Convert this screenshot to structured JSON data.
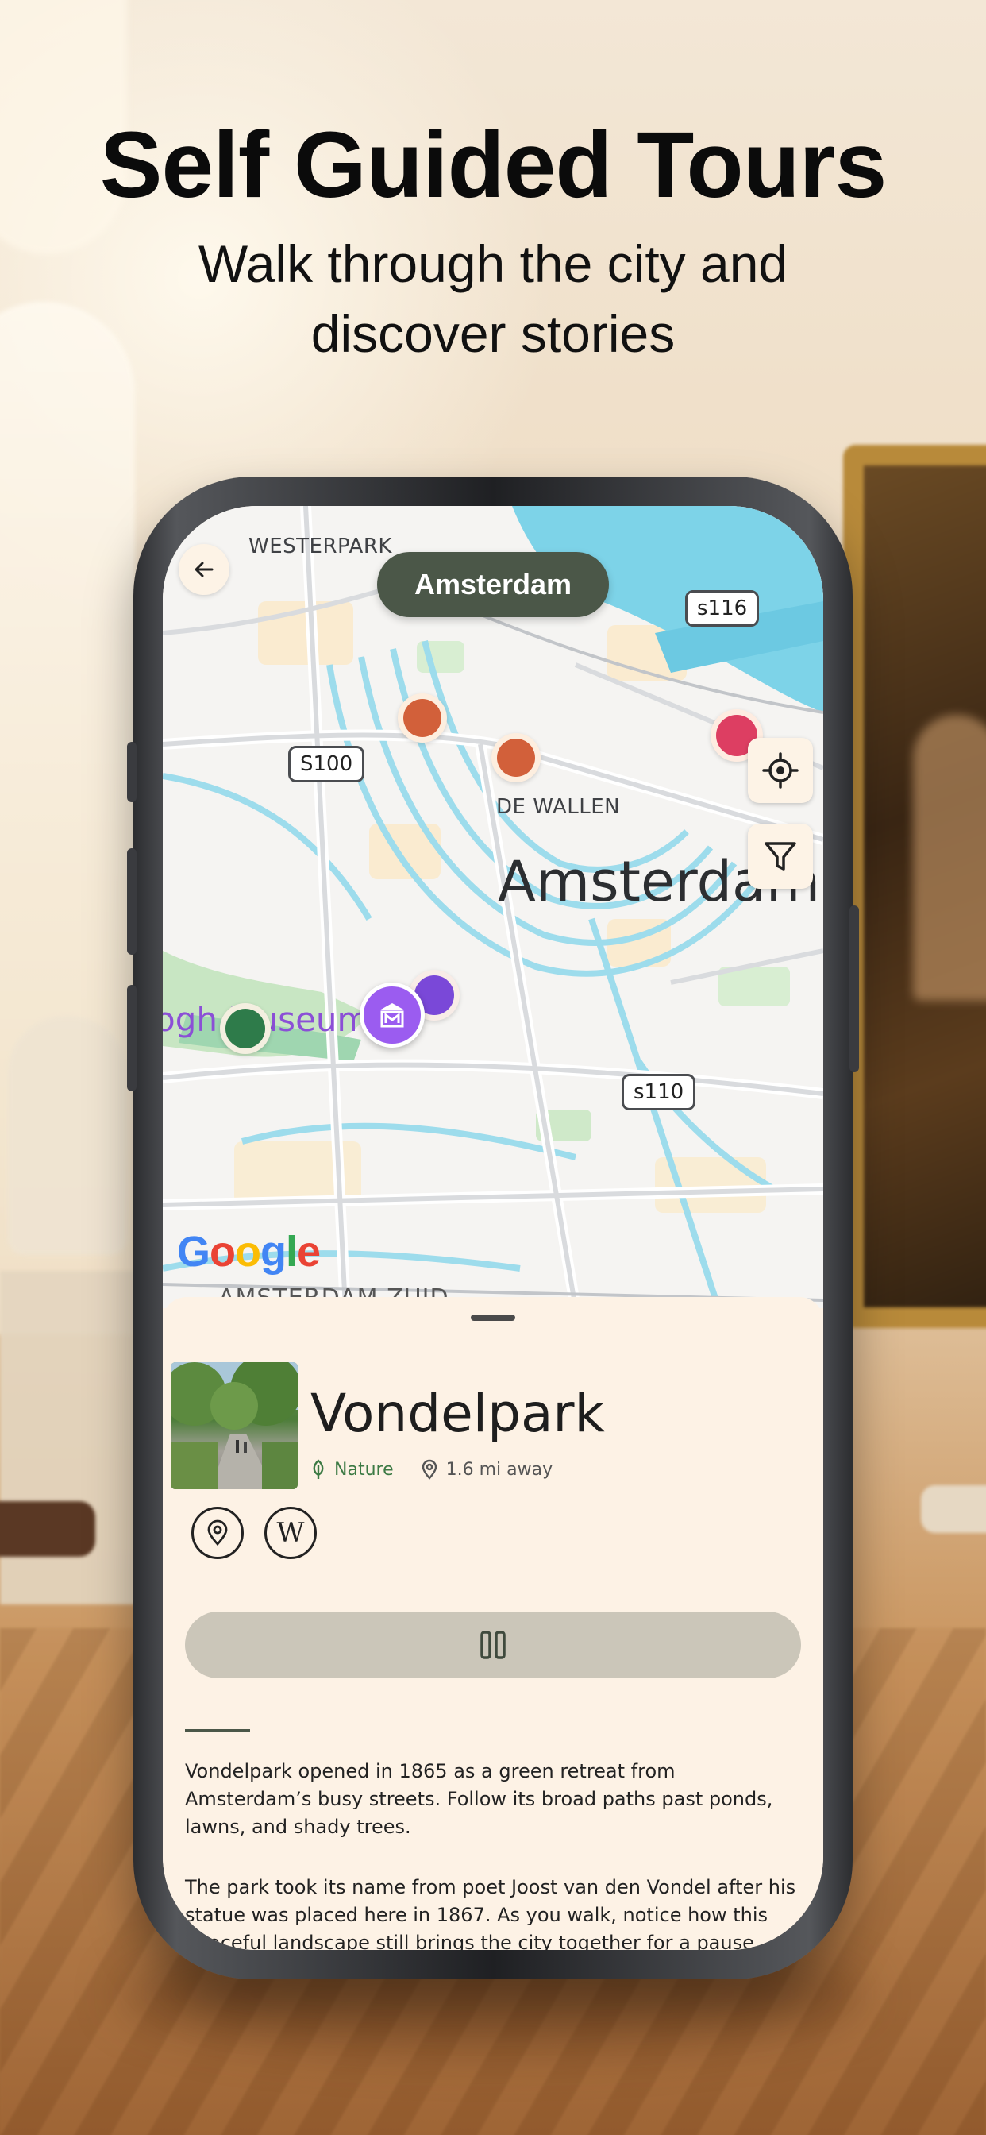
{
  "marketing": {
    "headline": "Self Guided Tours",
    "subheadline": "Walk through the city and discover stories"
  },
  "map": {
    "city_pill": "Amsterdam",
    "labels": {
      "westerpark": "WESTERPARK",
      "de_wallen": "DE WALLEN",
      "city": "Amsterdam",
      "museum": "ogh Museum",
      "zuid": "AMSTERDAM ZUID"
    },
    "road_shields": {
      "s100": "S100",
      "s116": "s116",
      "s110": "s110"
    },
    "google": "Google",
    "pins": [
      {
        "color": "#d2603a",
        "category": "orange"
      },
      {
        "color": "#d2603a",
        "category": "orange"
      },
      {
        "color": "#dd3e62",
        "category": "pink"
      },
      {
        "color": "#7a48d8",
        "category": "purple"
      },
      {
        "color": "#2e7b4a",
        "category": "nature"
      }
    ],
    "icons": {
      "back": "arrow-left-icon",
      "locate": "crosshair-icon",
      "filter": "filter-icon",
      "museum": "museum-icon"
    }
  },
  "place": {
    "title": "Vondelpark",
    "category": "Nature",
    "distance": "1.6 mi away",
    "description_1": "Vondelpark opened in 1865 as a green retreat from Amsterdam’s busy streets. Follow its broad paths past ponds, lawns, and shady trees.",
    "description_2": "The park took its name from poet Joost van den Vondel after his statue was placed here in 1867. As you walk, notice how this peaceful landscape still brings the city together for a pause outdoors.",
    "wiki_glyph": "W",
    "audio_state": "pause-icon"
  },
  "colors": {
    "accent": "#4b5748",
    "sheet_bg": "#fdf2e5",
    "nature_green": "#3c7a44",
    "audio_bar": "#cbc6b9"
  }
}
